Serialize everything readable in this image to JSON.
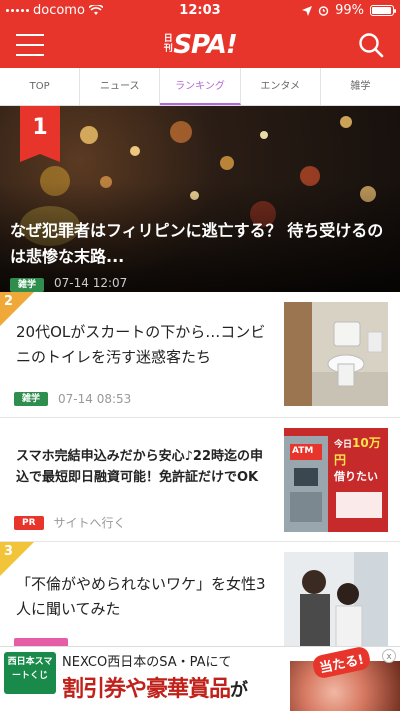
{
  "status_bar": {
    "carrier": "docomo",
    "time": "12:03",
    "battery": "99%"
  },
  "header": {
    "logo_small": "日刊",
    "logo_big": "SPA!"
  },
  "tabs": [
    {
      "label": "TOP"
    },
    {
      "label": "ニュース"
    },
    {
      "label": "ランキング",
      "active": true
    },
    {
      "label": "エンタメ"
    },
    {
      "label": "雑学"
    }
  ],
  "hero": {
    "rank": "1",
    "title": "なぜ犯罪者はフィリピンに逃亡する？ 待ち受けるのは悲惨な末路...",
    "category": "雑学",
    "date": "07-14 12:07"
  },
  "articles": [
    {
      "rank": "2",
      "title": "20代OLがスカートの下から…コンビニのトイレを汚す迷惑客たち",
      "category": "雑学",
      "date": "07-14 08:53"
    },
    {
      "title": "スマホ完結申込みだから安心♪22時迄の申込で最短即日融資可能！免許証だけでOK",
      "badge": "PR",
      "sponsor_text": "サイトへ行く",
      "thumb_atm": "ATM",
      "thumb_today": "今日",
      "thumb_amount": "10万円",
      "thumb_want": "借りたい"
    },
    {
      "rank": "3",
      "title": "「不倫がやめられないワケ」を女性3人に聞いてみた"
    }
  ],
  "banner": {
    "logo_text": "西日本スマートくじ",
    "line1": "NEXCO西日本のSA・PAにて",
    "line2_red": "割引券や豪華賞品",
    "line2_tail": "が",
    "hit_label": "当たる!",
    "close_label": "x"
  },
  "colors": {
    "brand_red": "#e8352c",
    "active_tab": "#b36ad4",
    "rank_corner": "#f0a838",
    "category_green": "#2f8d4e"
  }
}
